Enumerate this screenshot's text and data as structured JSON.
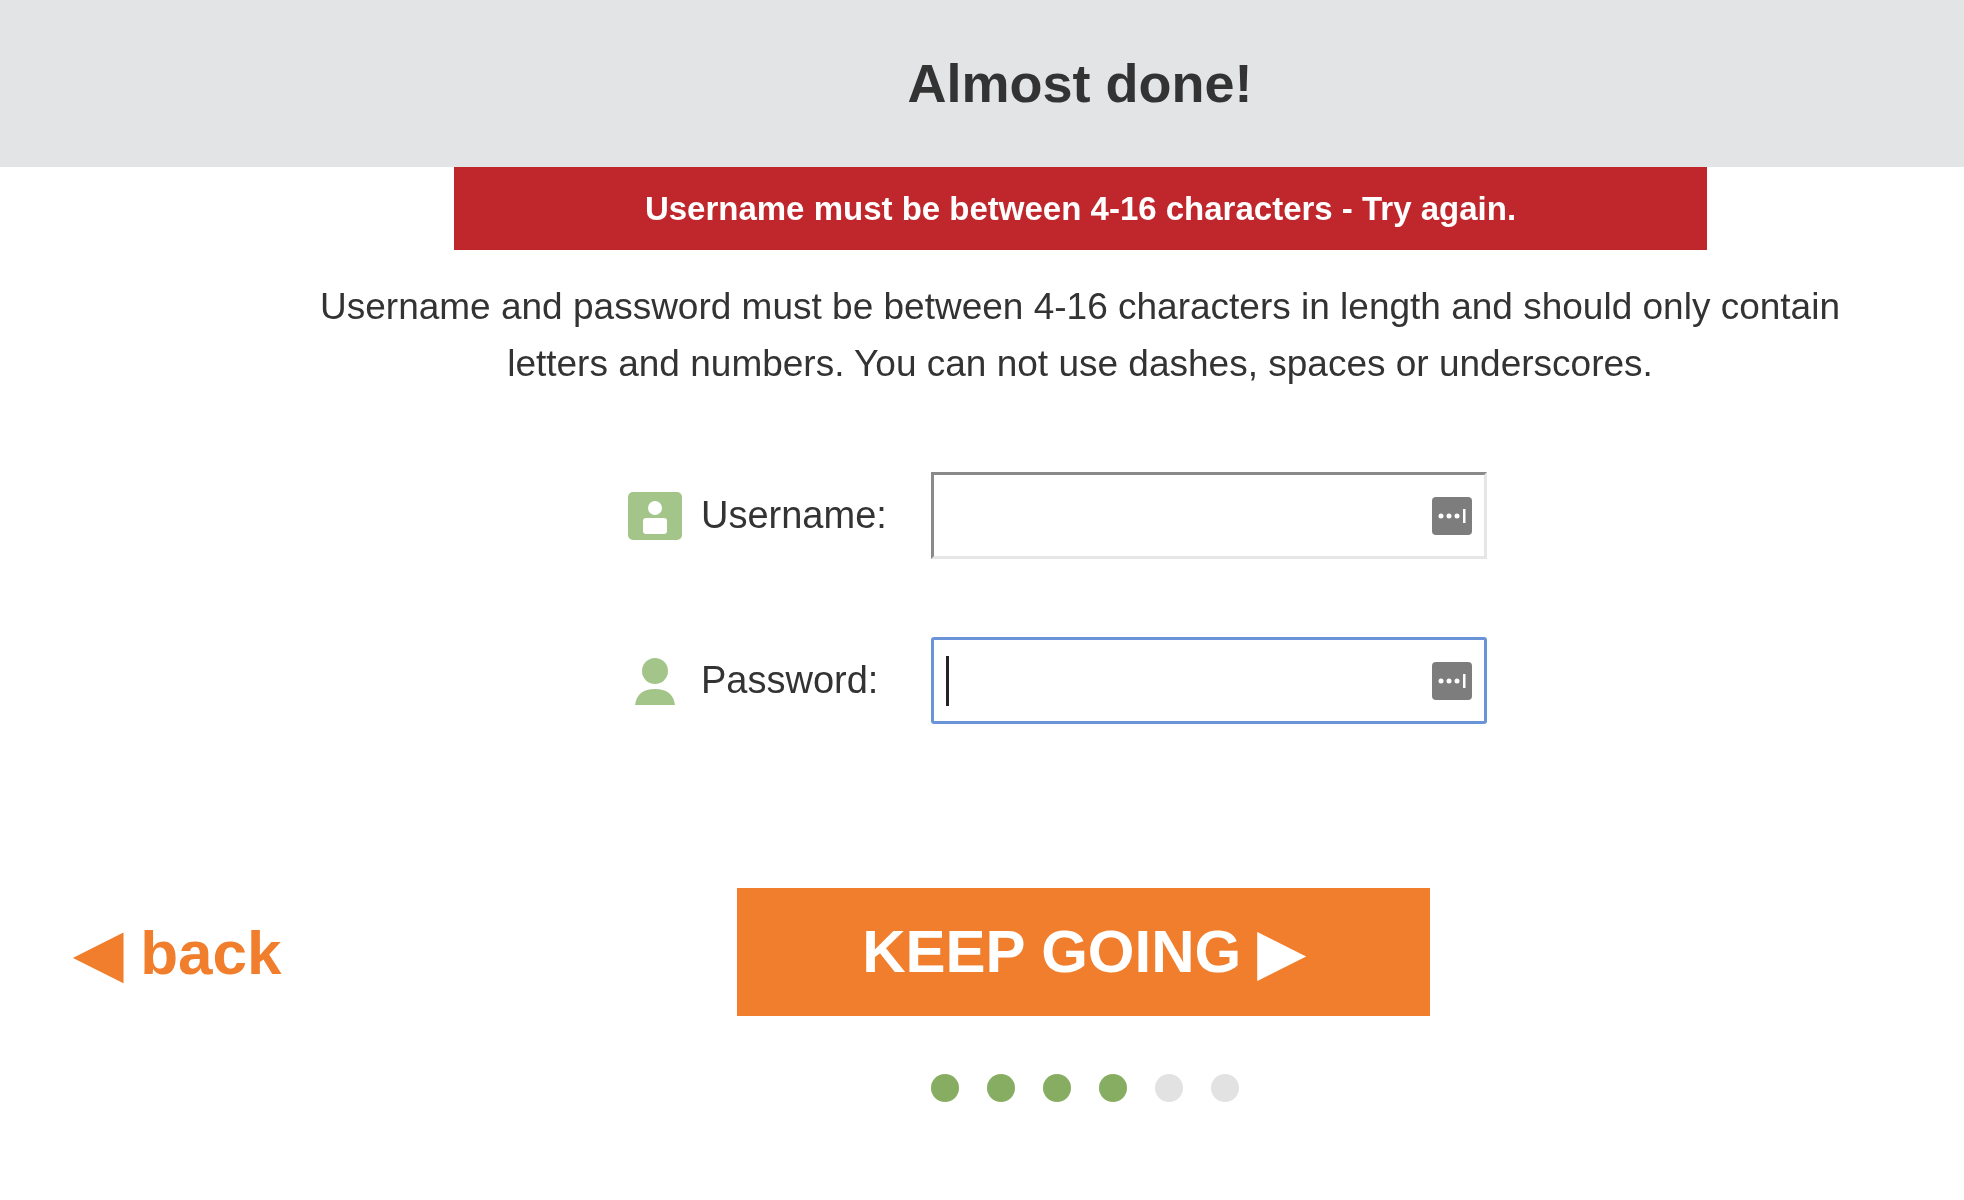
{
  "header": {
    "title": "Almost done!"
  },
  "error": {
    "message": "Username must be between 4-16 characters - Try again."
  },
  "instructions": "Username and password must be between 4-16 characters in length and should only contain letters and numbers. You can not use dashes, spaces or underscores.",
  "fields": [
    {
      "label": "Username:",
      "focused": false
    },
    {
      "label": "Password:",
      "focused": true
    }
  ],
  "back_link": {
    "label": "◀ back"
  },
  "continue_button": {
    "label": "KEEP GOING ▶"
  },
  "steps": [
    {
      "done": true
    },
    {
      "done": true
    },
    {
      "done": true
    },
    {
      "done": true
    },
    {
      "done": false
    },
    {
      "done": false
    }
  ]
}
